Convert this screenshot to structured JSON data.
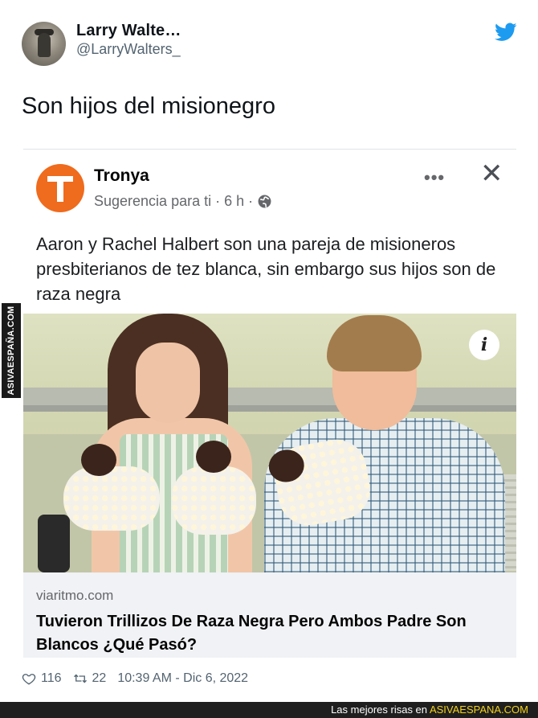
{
  "tweet": {
    "display_name": "Larry Walte…",
    "handle": "@LarryWalters_",
    "text": "Son hijos del misionegro",
    "icon_bird": "twitter-bird-icon",
    "likes": "116",
    "retweets": "22",
    "timestamp": "10:39 AM - Dic 6, 2022"
  },
  "embed": {
    "page_name": "Tronya",
    "suggestion": "Sugerencia para ti · 6 h ·",
    "more_icon": "•••",
    "close_icon": "✕",
    "post_text": "Aaron y Rachel Halbert son una pareja de misioneros presbiterianos de tez blanca, sin embargo sus hijos son de raza negra",
    "info_icon": "i",
    "link_domain": "viaritmo.com",
    "link_title": "Tuvieron Trillizos De Raza Negra Pero Ambos Padre Son Blancos ¿Qué Pasó?"
  },
  "watermark": {
    "side_text": "ASIVAESPAÑA.COM",
    "banner_prefix": "Las mejores risas en",
    "banner_brand": "ASIVAESPANA.COM"
  },
  "colors": {
    "twitter_blue": "#1d9bf0",
    "brand_orange": "#ef6b1d",
    "banner_yellow": "#f2d21b"
  }
}
